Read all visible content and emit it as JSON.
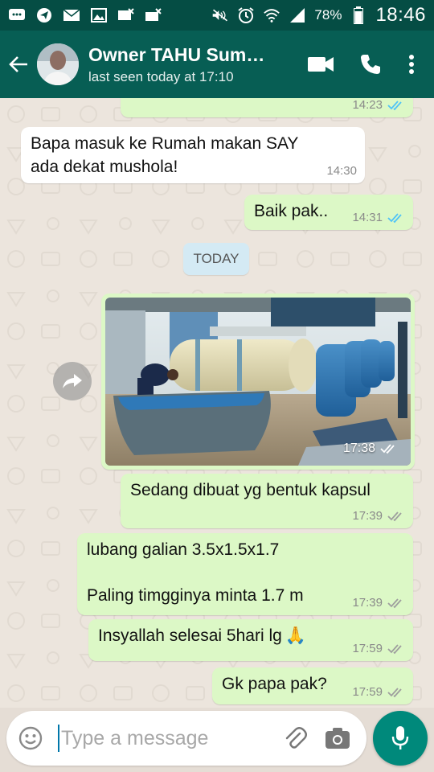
{
  "status_bar": {
    "battery": "78%",
    "time": "18:46",
    "icons": [
      "message-icon",
      "telegram-icon",
      "mail-icon",
      "image-icon",
      "missed-call-icon",
      "missed-call-icon",
      "mute-icon",
      "alarm-icon",
      "wifi-icon",
      "signal-icon",
      "battery-icon"
    ]
  },
  "header": {
    "contact_name": "Owner TAHU Sum…",
    "last_seen": "last seen today at 17:10"
  },
  "messages": [
    {
      "dir": "out",
      "text": "",
      "time": "14:23"
    },
    {
      "dir": "in",
      "text": "Bapa masuk ke Rumah makan SAY ada dekat mushola!",
      "time": "14:30"
    },
    {
      "dir": "out",
      "text": "Baik pak..",
      "time": "14:31"
    },
    {
      "dir": "out",
      "type": "image",
      "time": "17:38"
    },
    {
      "dir": "out",
      "text": "Sedang dibuat yg bentuk kapsul",
      "time": "17:39"
    },
    {
      "dir": "out",
      "text_line1": "lubang galian 3.5x1.5x1.7",
      "text_line2": "Paling timgginya minta 1.7 m",
      "time": "17:39"
    },
    {
      "dir": "out",
      "text": "Insyallah selesai 5hari lg",
      "emoji": "🙏",
      "time": "17:59"
    },
    {
      "dir": "out",
      "text": "Gk papa pak?",
      "time": "17:59"
    }
  ],
  "date_divider": "TODAY",
  "input": {
    "placeholder": "Type a message"
  },
  "colors": {
    "status_bar": "#054d44",
    "app_bar": "#075e54",
    "outgoing_bubble": "#dcf8c6",
    "incoming_bubble": "#ffffff",
    "read_ticks": "#4fc3f7",
    "mic_button": "#00897b"
  }
}
